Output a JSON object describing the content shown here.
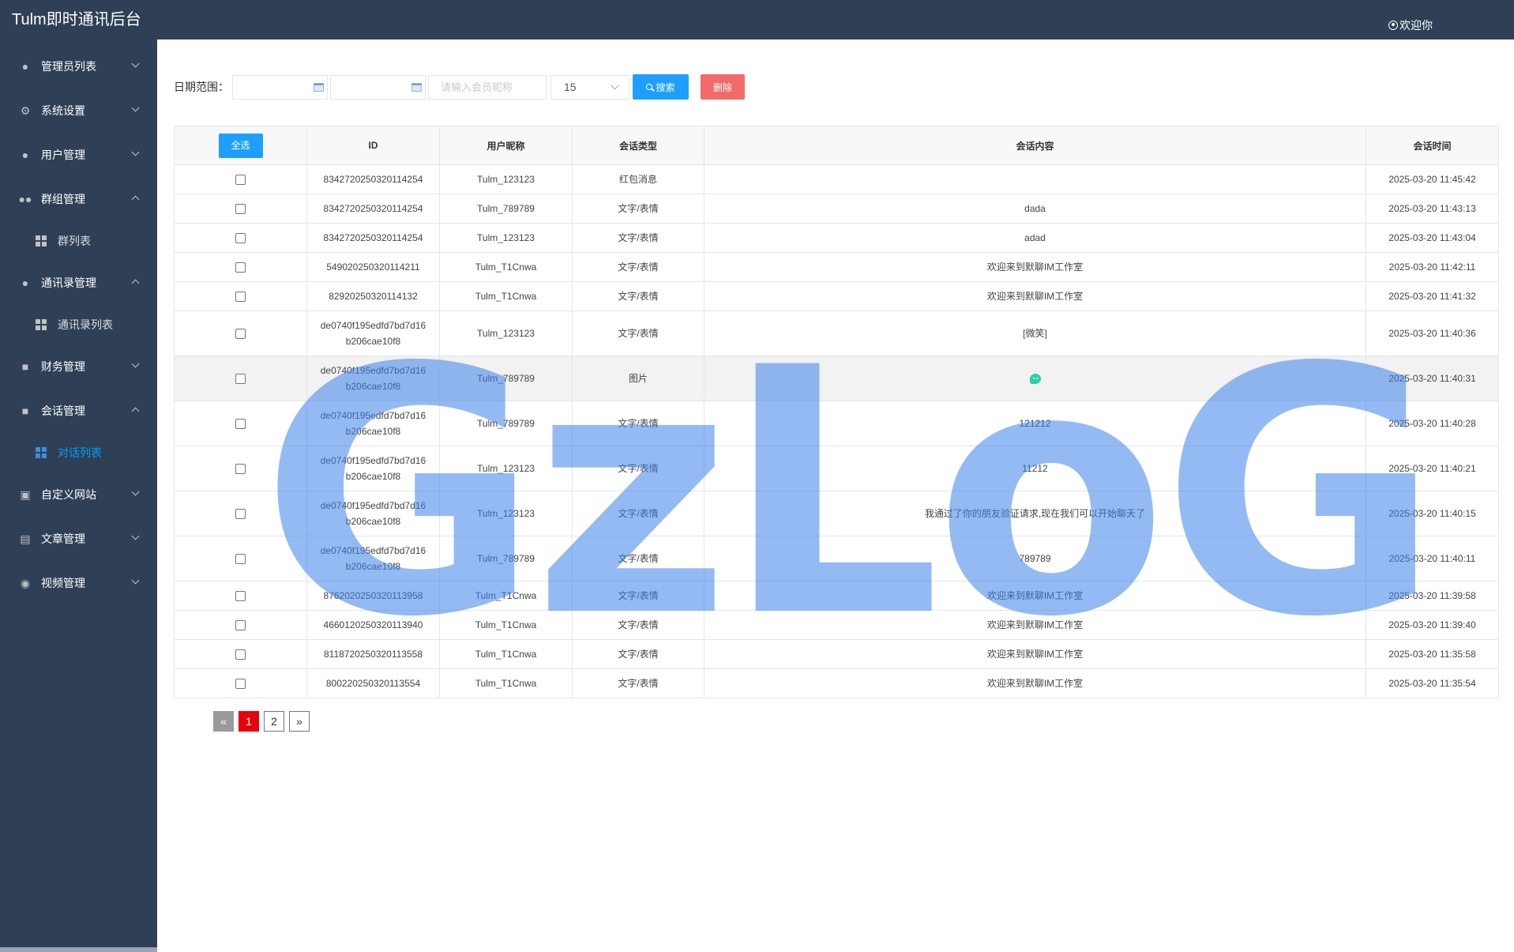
{
  "header": {
    "title": "Tulm即时通讯后台",
    "welcome": "欢迎你"
  },
  "sidebar": {
    "items": [
      {
        "label": "管理员列表",
        "icon": "user-icon",
        "expanded": false
      },
      {
        "label": "系统设置",
        "icon": "gear-icon",
        "expanded": false
      },
      {
        "label": "用户管理",
        "icon": "user-icon",
        "expanded": false
      },
      {
        "label": "群组管理",
        "icon": "group-icon",
        "expanded": true
      },
      {
        "label": "群列表",
        "icon": "grid-icon",
        "sub": true
      },
      {
        "label": "通讯录管理",
        "icon": "user-icon",
        "expanded": true
      },
      {
        "label": "通讯录列表",
        "icon": "grid-icon",
        "sub": true
      },
      {
        "label": "财务管理",
        "icon": "wallet-icon",
        "expanded": false
      },
      {
        "label": "会话管理",
        "icon": "chat-icon",
        "expanded": true
      },
      {
        "label": "对话列表",
        "icon": "grid-icon",
        "sub": true,
        "active": true
      },
      {
        "label": "自定义网站",
        "icon": "monitor-icon",
        "expanded": false
      },
      {
        "label": "文章管理",
        "icon": "document-icon",
        "expanded": false
      },
      {
        "label": "视频管理",
        "icon": "video-icon",
        "expanded": false
      }
    ]
  },
  "toolbar": {
    "date_label": "日期范围：",
    "start_date": "",
    "end_date": "",
    "nickname_placeholder": "请输入会员昵称",
    "page_size": "15",
    "search_label": "搜索",
    "delete_label": "删除"
  },
  "table": {
    "select_all_label": "全选",
    "columns": [
      "ID",
      "用户昵称",
      "会话类型",
      "会话内容",
      "会话时间"
    ],
    "rows": [
      {
        "id": "8342720250320114254",
        "nickname": "Tulm_123123",
        "type": "红包消息",
        "content": "",
        "time": "2025-03-20 11:45:42"
      },
      {
        "id": "8342720250320114254",
        "nickname": "Tulm_789789",
        "type": "文字/表情",
        "content": "dada",
        "time": "2025-03-20 11:43:13"
      },
      {
        "id": "8342720250320114254",
        "nickname": "Tulm_123123",
        "type": "文字/表情",
        "content": "adad",
        "time": "2025-03-20 11:43:04"
      },
      {
        "id": "549020250320114211",
        "nickname": "Tulm_T1Cnwa",
        "type": "文字/表情",
        "content": "欢迎来到默聊IM工作室",
        "time": "2025-03-20 11:42:11"
      },
      {
        "id": "82920250320114132",
        "nickname": "Tulm_T1Cnwa",
        "type": "文字/表情",
        "content": "欢迎来到默聊IM工作室",
        "time": "2025-03-20 11:41:32"
      },
      {
        "id_line1": "de0740f195edfd7bd7d16",
        "id_line2": "b206cae10f8",
        "nickname": "Tulm_123123",
        "type": "文字/表情",
        "content": "[微笑]",
        "time": "2025-03-20 11:40:36"
      },
      {
        "id_line1": "de0740f195edfd7bd7d16",
        "id_line2": "b206cae10f8",
        "nickname": "Tulm_789789",
        "type": "图片",
        "content": "",
        "content_icon": "emoji-icon",
        "time": "2025-03-20 11:40:31",
        "highlight": true
      },
      {
        "id_line1": "de0740f195edfd7bd7d16",
        "id_line2": "b206cae10f8",
        "nickname": "Tulm_789789",
        "type": "文字/表情",
        "content": "121212",
        "time": "2025-03-20 11:40:28"
      },
      {
        "id_line1": "de0740f195edfd7bd7d16",
        "id_line2": "b206cae10f8",
        "nickname": "Tulm_123123",
        "type": "文字/表情",
        "content": "11212",
        "time": "2025-03-20 11:40:21"
      },
      {
        "id_line1": "de0740f195edfd7bd7d16",
        "id_line2": "b206cae10f8",
        "nickname": "Tulm_123123",
        "type": "文字/表情",
        "content": "我通过了你的朋友验证请求,现在我们可以开始聊天了",
        "time": "2025-03-20 11:40:15"
      },
      {
        "id_line1": "de0740f195edfd7bd7d16",
        "id_line2": "b206cae10f8",
        "nickname": "Tulm_789789",
        "type": "文字/表情",
        "content": "789789",
        "time": "2025-03-20 11:40:11"
      },
      {
        "id": "876202025032011395 8",
        "nickname": "Tulm_T1Cnwa",
        "type": "文字/表情",
        "content": "欢迎来到默聊IM工作室",
        "time": "2025-03-20 11:39:58"
      },
      {
        "id": "4660120250320113940",
        "nickname": "Tulm_T1Cnwa",
        "type": "文字/表情",
        "content": "欢迎来到默聊IM工作室",
        "time": "2025-03-20 11:39:40"
      },
      {
        "id": "8118720250320113558",
        "nickname": "Tulm_T1Cnwa",
        "type": "文字/表情",
        "content": "欢迎来到默聊IM工作室",
        "time": "2025-03-20 11:35:58"
      },
      {
        "id": "800220250320113554",
        "nickname": "Tulm_T1Cnwa",
        "type": "文字/表情",
        "content": "欢迎来到默聊IM工作室",
        "time": "2025-03-20 11:35:54"
      }
    ]
  },
  "pagination": {
    "prev": "«",
    "pages": [
      "1",
      "2"
    ],
    "current": "1",
    "next": "»"
  },
  "watermark": "GzLoG",
  "colors": {
    "sidebar_bg": "#2f4056",
    "primary": "#1e9fff",
    "danger": "#f36a6a",
    "active_page": "#e8000b",
    "watermark": "#3c82eb"
  }
}
